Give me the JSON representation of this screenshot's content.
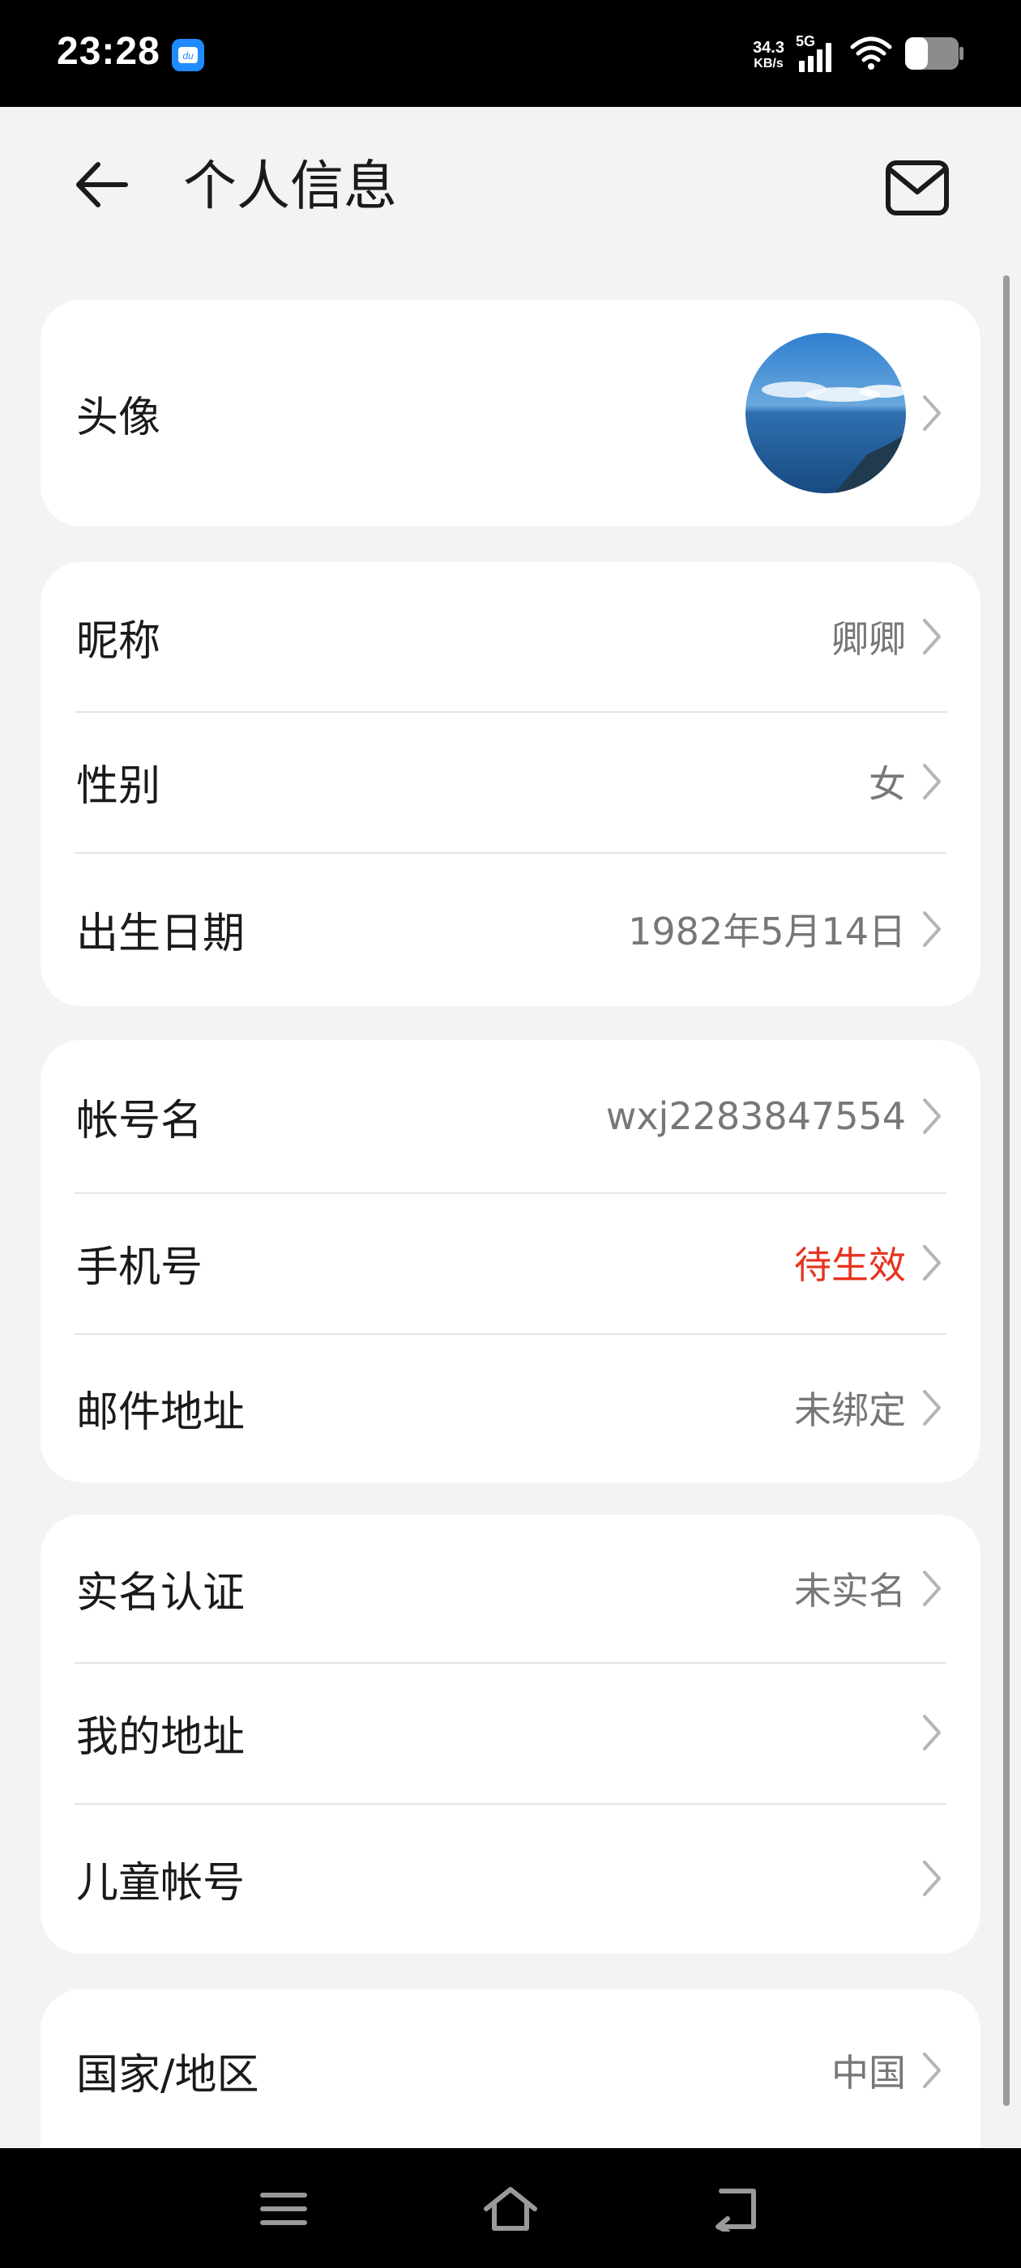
{
  "status_bar": {
    "time": "23:28",
    "net_speed_value": "34.3",
    "net_speed_unit": "KB/s",
    "signal_label": "5G",
    "icons": [
      "du-app-icon",
      "signal-icon",
      "wifi-icon",
      "battery-icon"
    ]
  },
  "header": {
    "title": "个人信息",
    "back_icon": "arrow-left-icon",
    "mail_icon": "mail-icon"
  },
  "sections": [
    {
      "rows": [
        {
          "label": "头像",
          "type": "avatar"
        }
      ]
    },
    {
      "rows": [
        {
          "label": "昵称",
          "value": "卿卿"
        },
        {
          "label": "性别",
          "value": "女"
        },
        {
          "label": "出生日期",
          "value": "1982年5月14日"
        }
      ]
    },
    {
      "rows": [
        {
          "label": "帐号名",
          "value": "wxj2283847554"
        },
        {
          "label": "手机号",
          "value": "待生效",
          "value_color": "#e8321f"
        },
        {
          "label": "邮件地址",
          "value": "未绑定"
        }
      ]
    },
    {
      "rows": [
        {
          "label": "实名认证",
          "value": "未实名"
        },
        {
          "label": "我的地址",
          "value": ""
        },
        {
          "label": "儿童帐号",
          "value": ""
        }
      ]
    },
    {
      "rows": [
        {
          "label": "国家/地区",
          "value": "中国"
        }
      ]
    }
  ],
  "nav_bar": {
    "icons": [
      "menu-icon",
      "home-icon",
      "back-icon"
    ]
  },
  "colors": {
    "background": "#f1f3f5",
    "card": "#ffffff",
    "warning": "#e8321f"
  }
}
